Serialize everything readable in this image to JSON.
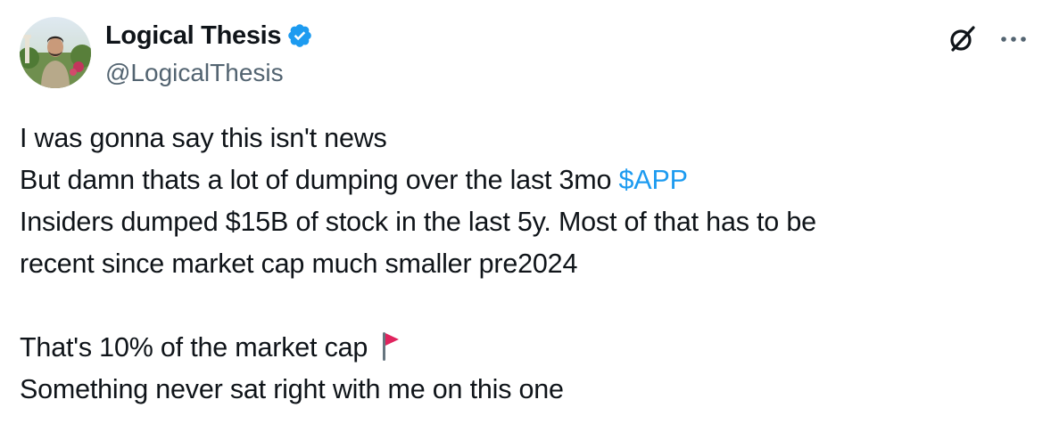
{
  "author": {
    "display_name": "Logical Thesis",
    "handle": "@LogicalThesis",
    "verified": true,
    "verified_icon": "verified-badge-icon"
  },
  "actions": {
    "grok_icon": "grok-icon",
    "more_icon": "more-options-icon"
  },
  "tweet": {
    "line1": "I was gonna say this isn't news",
    "line2_prefix": "But damn thats a lot of dumping over the last 3mo ",
    "line2_cashtag": "$APP",
    "line3": "Insiders dumped $15B of stock in the last 5y. Most of that has to be",
    "line4": "recent since market cap much smaller pre2024",
    "line5_text": "That's 10% of the market cap ",
    "line5_emoji": "red-flag-emoji",
    "line6": "Something never sat right with me on this one"
  },
  "colors": {
    "text": "#0f1419",
    "secondary": "#536471",
    "accent": "#1d9bf0",
    "flag": "#e0245e"
  }
}
